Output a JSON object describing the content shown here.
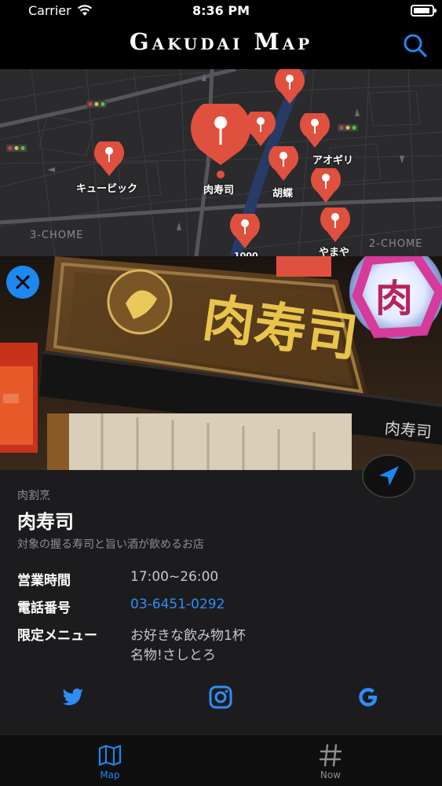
{
  "status": {
    "carrier": "Carrier",
    "time": "8:36 PM"
  },
  "nav": {
    "title": "Gakudai Map"
  },
  "map": {
    "pins": [
      "キュービック",
      "肉寿司",
      "胡蝶",
      "アオギリ",
      "やまや",
      "1000"
    ],
    "areas": [
      "3-CHOME",
      "2-CHOME"
    ]
  },
  "shop": {
    "category": "肉割烹",
    "name": "肉寿司",
    "description": "対象の握る寿司と旨い酒が飲めるお店",
    "sign_text": "肉寿司",
    "sign_small": "肉寿司",
    "sign_neon": "肉",
    "hours_label": "営業時間",
    "hours_value": "17:00~26:00",
    "phone_label": "電話番号",
    "phone_value": "03-6451-0292",
    "menu_label": "限定メニュー",
    "menu_line1": "お好きな飲み物1杯",
    "menu_line2": "名物!さしとろ"
  },
  "tabs": [
    {
      "label": "Map",
      "active": true
    },
    {
      "label": "Now",
      "active": false
    }
  ],
  "colors": {
    "accent": "#1e88f0",
    "pin": "#e0503f",
    "link": "#2f8df6",
    "inactive_tab": "#8e8e93"
  },
  "icons": [
    "wifi-icon",
    "search-icon",
    "close-icon",
    "location-arrow-icon",
    "twitter-icon",
    "instagram-icon",
    "google-icon",
    "map-icon",
    "hash-icon"
  ]
}
